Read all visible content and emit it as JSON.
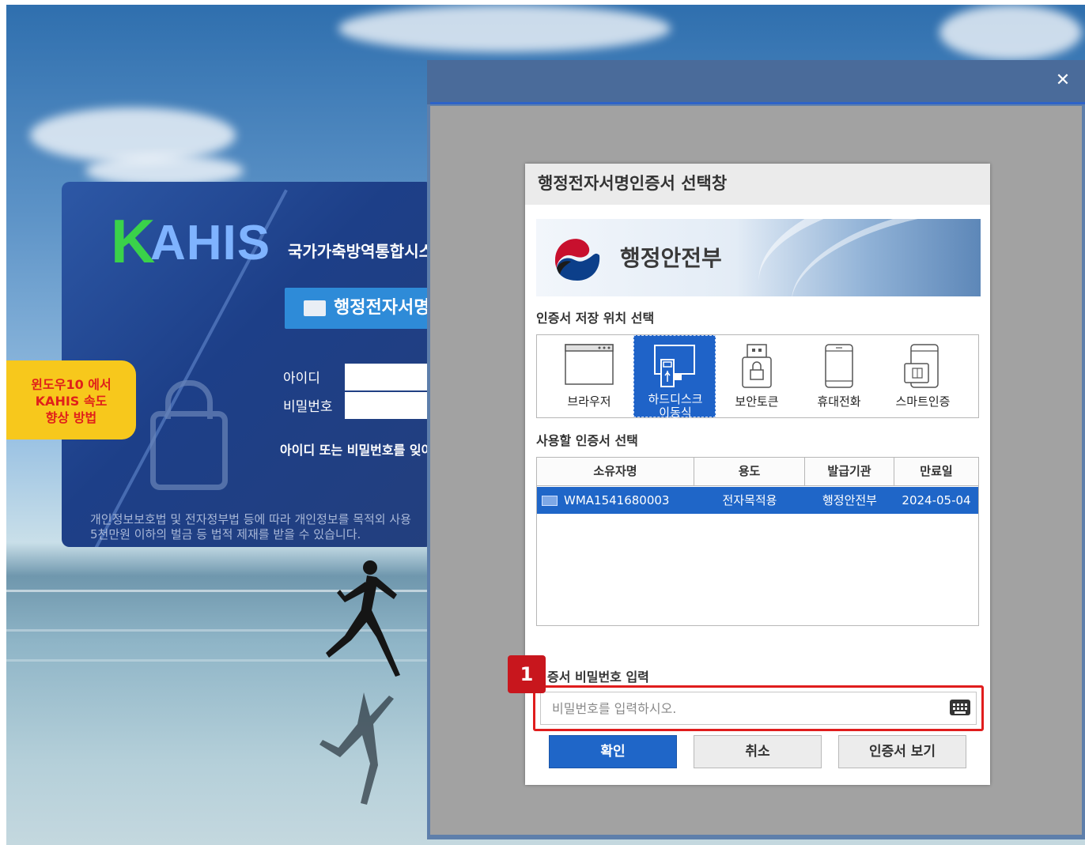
{
  "background": {
    "login": {
      "logo_k": "K",
      "logo_rest": "AHIS",
      "system_name": "국가가축방역통합시스",
      "sign_button": "행정전자서명",
      "id_label": "아이디",
      "pw_label": "비밀번호",
      "forgot": "아이디 또는 비밀번호를 잊어",
      "notice_line1": "개인정보보호법 및 전자정부법 등에 따라 개인정보를 목적외 사용",
      "notice_line2": "5천만원 이하의 벌금 등 법적 제재를 받을 수 있습니다."
    },
    "badge": {
      "line1": "윈도우10 에서",
      "line2": "KAHIS 속도",
      "line3": "향상 방법"
    }
  },
  "popup": {
    "close_icon": "close-icon"
  },
  "dialog": {
    "title": "행정전자서명인증서 선택창",
    "ministry": "행정안전부",
    "location_label": "인증서 저장 위치 선택",
    "locations": [
      {
        "label": "브라우저",
        "icon": "browser-window-icon",
        "selected": false
      },
      {
        "label_line1": "하드디스크",
        "label_line2": "이동식",
        "icon": "removable-disk-icon",
        "selected": true
      },
      {
        "label": "보안토큰",
        "icon": "security-token-icon",
        "selected": false
      },
      {
        "label": "휴대전화",
        "icon": "mobile-phone-icon",
        "selected": false
      },
      {
        "label": "스마트인증",
        "icon": "smart-card-icon",
        "selected": false
      }
    ],
    "cert_label": "사용할 인증서 선택",
    "table": {
      "headers": [
        "소유자명",
        "용도",
        "발급기관",
        "만료일"
      ],
      "rows": [
        {
          "owner": "WMA1541680003",
          "usage": "전자목적용",
          "issuer": "행정안전부",
          "expiry": "2024-05-04",
          "selected": true
        }
      ]
    },
    "password_label": "증서 비밀번호 입력",
    "password_placeholder": "비밀번호를 입력하시오.",
    "step_number": "1",
    "buttons": {
      "confirm": "확인",
      "cancel": "취소",
      "view": "인증서 보기"
    },
    "colors": {
      "accent": "#1f66c8",
      "highlight": "#e01d1d",
      "step_badge": "#c8161d"
    }
  }
}
